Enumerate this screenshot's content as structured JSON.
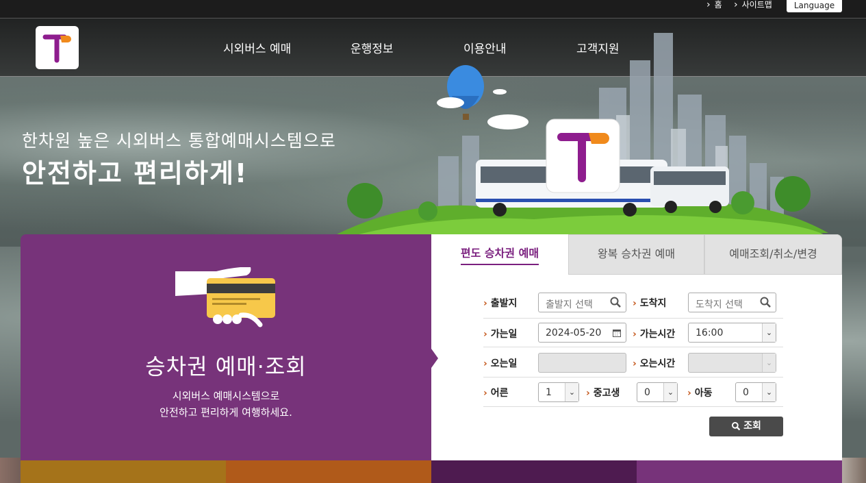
{
  "util": {
    "home": "홈",
    "sitemap": "사이트맵",
    "language": "Language"
  },
  "nav": {
    "items": [
      "시외버스 예매",
      "운행정보",
      "이용안내",
      "고객지원"
    ]
  },
  "hero": {
    "subtitle": "한차원 높은 시외버스 통합예매시스템으로",
    "title": "안전하고 편리하게!"
  },
  "promo": {
    "title": "승차권 예매·조회",
    "desc1": "시외버스 예매시스템으로",
    "desc2": "안전하고 편리하게 여행하세요."
  },
  "tabs": [
    "편도 승차권 예매",
    "왕복 승차권 예매",
    "예매조회/취소/변경"
  ],
  "form": {
    "departure": {
      "label": "출발지",
      "placeholder": "출발지 선택"
    },
    "arrival": {
      "label": "도착지",
      "placeholder": "도착지 선택"
    },
    "go_date": {
      "label": "가는일",
      "value": "2024-05-20"
    },
    "go_time": {
      "label": "가는시간",
      "value": "16:00"
    },
    "return_date": {
      "label": "오는일",
      "value": ""
    },
    "return_time": {
      "label": "오는시간",
      "value": ""
    },
    "adult": {
      "label": "어른",
      "value": "1"
    },
    "youth": {
      "label": "중고생",
      "value": "0"
    },
    "child": {
      "label": "아동",
      "value": "0"
    },
    "search_label": "조회"
  },
  "colors": {
    "purple": "#77337a",
    "accent_orange": "#f08a1c",
    "tab_active": "#7a1f7e"
  }
}
